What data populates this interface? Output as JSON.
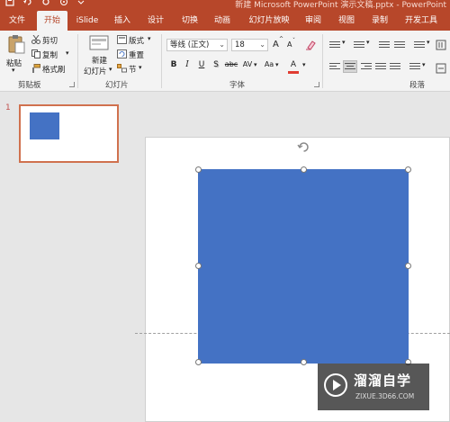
{
  "title_bar": {
    "document_title": "新建 Microsoft PowerPoint 演示文稿.pptx - PowerPoint",
    "quick_access_icons": [
      "save-icon",
      "undo-icon",
      "redo-icon",
      "touch-mode-icon",
      "customize-icon"
    ]
  },
  "tabs": [
    "文件",
    "开始",
    "iSlide",
    "插入",
    "设计",
    "切换",
    "动画",
    "幻灯片放映",
    "审阅",
    "视图",
    "录制",
    "开发工具"
  ],
  "active_tab": "开始",
  "ribbon": {
    "clipboard": {
      "paste": "粘贴",
      "cut": "剪切",
      "copy": "复制",
      "format_painter": "格式刷",
      "group": "剪贴板"
    },
    "slides": {
      "new_slide_line1": "新建",
      "new_slide_line2": "幻灯片",
      "layout": "版式",
      "reset": "重置",
      "section": "节",
      "group": "幻灯片"
    },
    "font": {
      "font_name": "等线 (正文)",
      "font_size": "18",
      "grow": "A",
      "shrink": "A",
      "bold": "B",
      "italic": "I",
      "underline": "U",
      "shadow": "S",
      "strikethrough": "abc",
      "spacing": "AV",
      "case": "Aa",
      "color": "A",
      "group": "字体"
    },
    "paragraph": {
      "group": "段落"
    }
  },
  "slides_pane": {
    "slide_number": "1"
  },
  "watermark": {
    "title": "溜溜自学",
    "url": "ZIXUE.3D66.COM"
  },
  "colors": {
    "accent": "#b7472a",
    "shape_fill": "#4472c4",
    "thumb_border": "#d0714e",
    "font_color_bar": "#e03c31"
  }
}
